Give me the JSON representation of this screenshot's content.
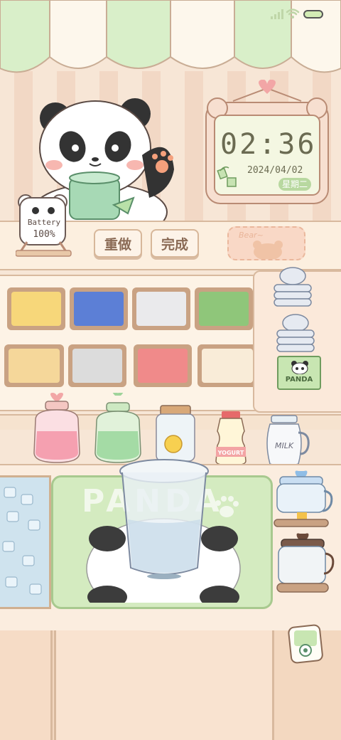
{
  "status_bar": {
    "signal_icon": "signal-bars-icon",
    "wifi_icon": "wifi-icon",
    "battery_icon": "battery-icon"
  },
  "battery_widget": {
    "label": "Battery",
    "value": "100%"
  },
  "clock_widget": {
    "time": "02:36",
    "date": "2024/04/02",
    "weekday": "星期二"
  },
  "buttons": {
    "redo": "重做",
    "done": "完成"
  },
  "bear_tray": {
    "label": "Bear~"
  },
  "cup_stack": {
    "book_label": "PANDA"
  },
  "bottles": {
    "yogurt_label": "YOGURT",
    "milk_label": "MILK"
  },
  "mat": {
    "label": "PANDA"
  },
  "colors": {
    "awning_green": "#d9efc9",
    "cream": "#fdf6ea",
    "counter": "#f6e0c8",
    "wood": "#caa787",
    "mat_green": "#d4ebc0"
  }
}
